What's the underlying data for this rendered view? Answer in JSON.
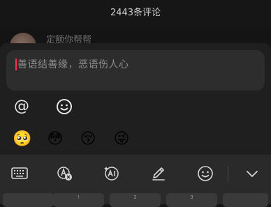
{
  "header": {
    "title": "2443条评论"
  },
  "comment_peek": {
    "name": "定额你帮帮"
  },
  "input": {
    "placeholder": "善语结善缘，恶语伤人心"
  },
  "tools": {
    "mention_symbol": "@",
    "emoji_icon": "smiley-face-icon"
  },
  "emojis": [
    "🥺",
    "😳",
    "😚",
    "😜"
  ],
  "keyboard": {
    "icons": [
      "keyboard-icon",
      "translate-icon",
      "ai-assistant-icon",
      "handwriting-icon",
      "emoji-panel-icon",
      "collapse-chevron-icon"
    ],
    "key_hints": [
      "",
      "!",
      "2",
      "3",
      ""
    ]
  },
  "colors": {
    "caret": "#ff2d55",
    "background": "#161616",
    "panel": "#1f1f1f"
  }
}
